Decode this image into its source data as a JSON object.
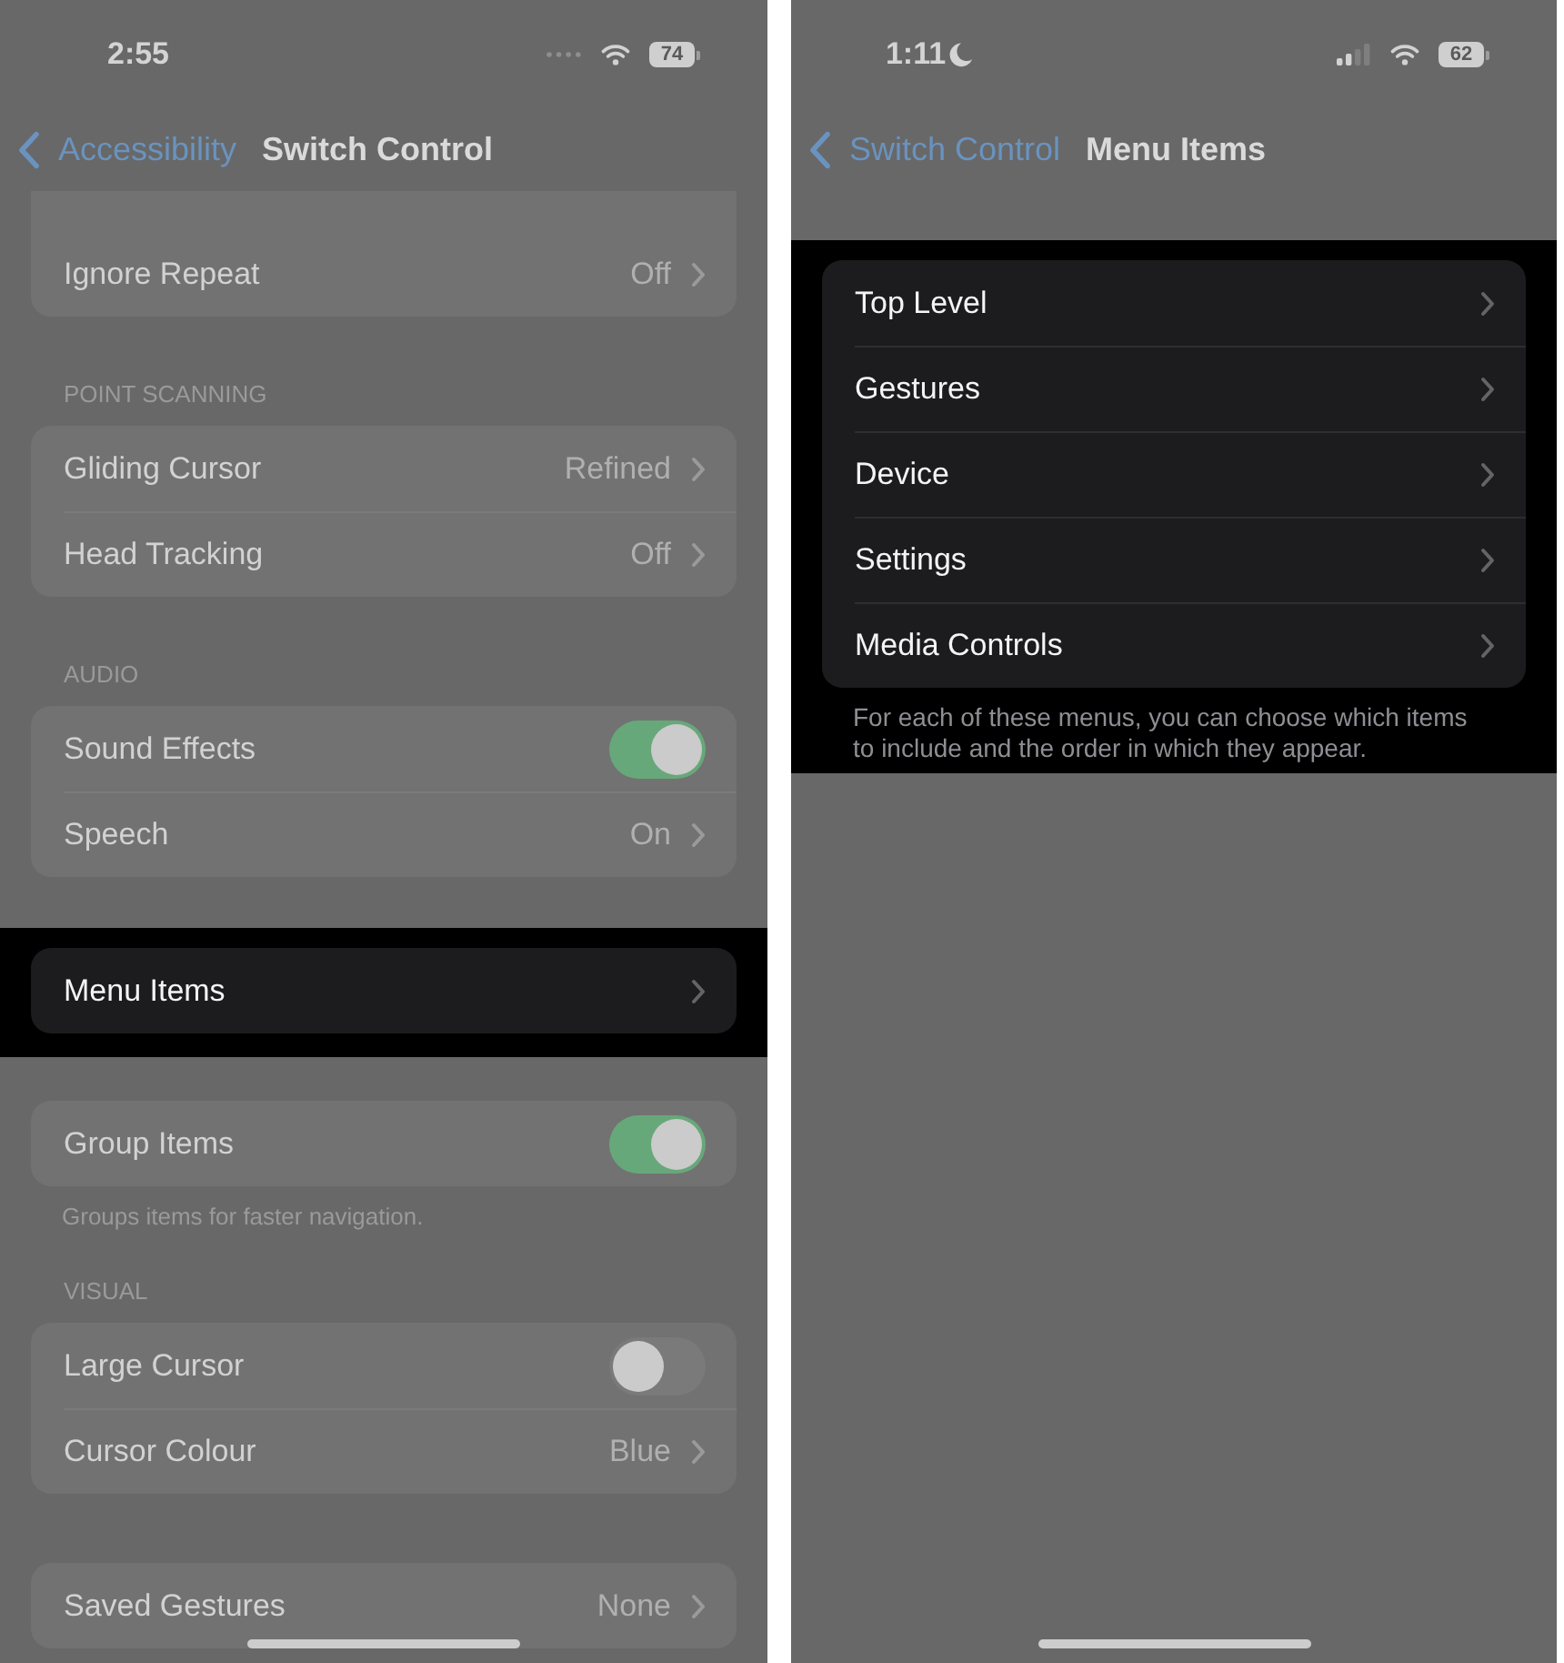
{
  "screens": [
    {
      "status_bar": {
        "time": "2:55",
        "cellular_signal": false,
        "battery": "74"
      },
      "nav_bar": {
        "back": "Accessibility",
        "title": "Switch Control"
      },
      "sections": [
        {
          "highlighted": false,
          "clipped_top": true,
          "rows": [
            {
              "kind": "value",
              "label": "Ignore Repeat",
              "value": "Off"
            }
          ]
        },
        {
          "header": "POINT SCANNING",
          "highlighted": false,
          "rows": [
            {
              "kind": "value",
              "label": "Gliding Cursor",
              "value": "Refined"
            },
            {
              "kind": "value",
              "label": "Head Tracking",
              "value": "Off"
            }
          ]
        },
        {
          "header": "AUDIO",
          "highlighted": false,
          "rows": [
            {
              "kind": "toggle",
              "label": "Sound Effects",
              "on": true
            },
            {
              "kind": "value",
              "label": "Speech",
              "value": "On"
            }
          ]
        },
        {
          "highlighted": true,
          "rows": [
            {
              "kind": "link",
              "label": "Menu Items"
            }
          ]
        },
        {
          "highlighted": false,
          "rows": [
            {
              "kind": "toggle",
              "label": "Group Items",
              "on": true
            }
          ],
          "footer": "Groups items for faster navigation."
        },
        {
          "header": "VISUAL",
          "highlighted": false,
          "rows": [
            {
              "kind": "toggle",
              "label": "Large Cursor",
              "on": false
            },
            {
              "kind": "value",
              "label": "Cursor Colour",
              "value": "Blue"
            }
          ]
        },
        {
          "highlighted": false,
          "rows": [
            {
              "kind": "value",
              "label": "Saved Gestures",
              "value": "None"
            }
          ]
        }
      ]
    },
    {
      "status_bar": {
        "time": "1:11",
        "focus_mode": true,
        "cellular_signal": true,
        "battery": "62"
      },
      "nav_bar": {
        "back": "Switch Control",
        "title": "Menu Items"
      },
      "sections": [
        {
          "highlighted": true,
          "rows": [
            {
              "kind": "link",
              "label": "Top Level"
            },
            {
              "kind": "link",
              "label": "Gestures"
            },
            {
              "kind": "link",
              "label": "Device"
            },
            {
              "kind": "link",
              "label": "Settings"
            },
            {
              "kind": "link",
              "label": "Media Controls"
            }
          ],
          "footer": "For each of these menus, you can choose which items to include and the order in which they appear."
        }
      ]
    }
  ]
}
